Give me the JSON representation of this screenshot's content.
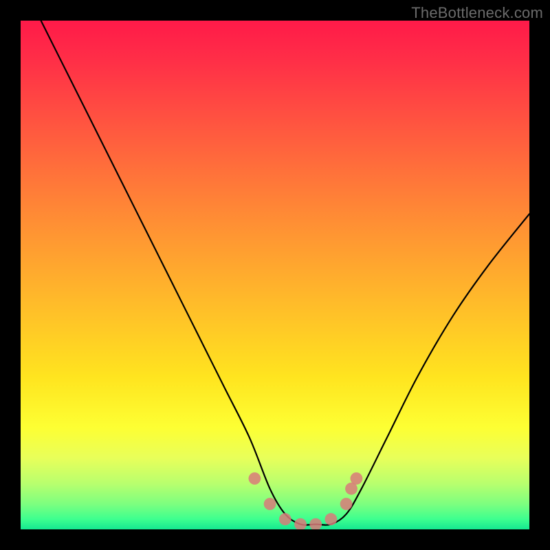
{
  "watermark": "TheBottleneck.com",
  "chart_data": {
    "type": "line",
    "title": "",
    "xlabel": "",
    "ylabel": "",
    "xlim": [
      0,
      100
    ],
    "ylim": [
      0,
      100
    ],
    "grid": false,
    "legend": false,
    "background_gradient": {
      "direction": "vertical",
      "stops": [
        {
          "pos": 0,
          "color": "#ff1a49"
        },
        {
          "pos": 22,
          "color": "#ff5a3f"
        },
        {
          "pos": 55,
          "color": "#ffba2a"
        },
        {
          "pos": 80,
          "color": "#fdff33"
        },
        {
          "pos": 95,
          "color": "#7dff7f"
        },
        {
          "pos": 100,
          "color": "#15e890"
        }
      ]
    },
    "series": [
      {
        "name": "bottleneck-curve",
        "color": "#000000",
        "x": [
          4,
          10,
          15,
          20,
          25,
          30,
          35,
          40,
          45,
          49,
          52,
          55,
          58,
          61,
          64,
          67,
          72,
          78,
          85,
          92,
          100
        ],
        "values": [
          100,
          88,
          78,
          68,
          58,
          48,
          38,
          28,
          18,
          8,
          3,
          1,
          1,
          1,
          3,
          8,
          18,
          30,
          42,
          52,
          62
        ]
      }
    ],
    "markers": {
      "name": "trough-markers",
      "color": "#d97a7a",
      "radius_approx": 1.2,
      "x": [
        46,
        49,
        52,
        55,
        58,
        61,
        64,
        65,
        66
      ],
      "values": [
        10,
        5,
        2,
        1,
        1,
        2,
        5,
        8,
        10
      ]
    }
  }
}
